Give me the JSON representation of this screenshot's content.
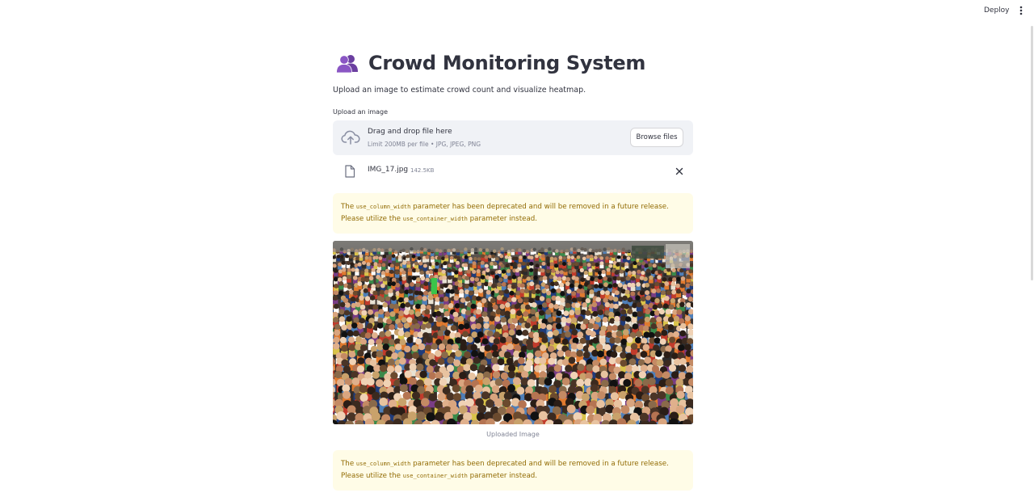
{
  "header": {
    "deploy_label": "Deploy",
    "menu_icon": "more-vertical-icon"
  },
  "page": {
    "title_emoji": "busts-in-silhouette-icon",
    "title": "Crowd Monitoring System",
    "subtitle": "Upload an image to estimate crowd count and visualize heatmap."
  },
  "uploader": {
    "label": "Upload an image",
    "drop_title": "Drag and drop file here",
    "drop_limit": "Limit 200MB per file • JPG, JPEG, PNG",
    "browse_label": "Browse files",
    "icon": "cloud-upload-icon"
  },
  "uploaded_file": {
    "name": "IMG_17.jpg",
    "size": "142.5KB",
    "icon": "file-icon",
    "remove_icon": "close-icon"
  },
  "warnings": [
    {
      "before": "The ",
      "code1": "use_column_width",
      "middle": " parameter has been deprecated and will be removed in a future release. Please utilize the ",
      "code2": "use_container_width",
      "after": " parameter instead."
    },
    {
      "before": "The ",
      "code1": "use_column_width",
      "middle": " parameter has been deprecated and will be removed in a future release. Please utilize the ",
      "code2": "use_container_width",
      "after": " parameter instead."
    }
  ],
  "image": {
    "caption": "Uploaded Image"
  },
  "colors": {
    "dropzone_bg": "#f0f2f6",
    "warning_bg": "#fffce7",
    "warning_text": "#926c05",
    "text": "#31333f",
    "muted": "#808495"
  }
}
